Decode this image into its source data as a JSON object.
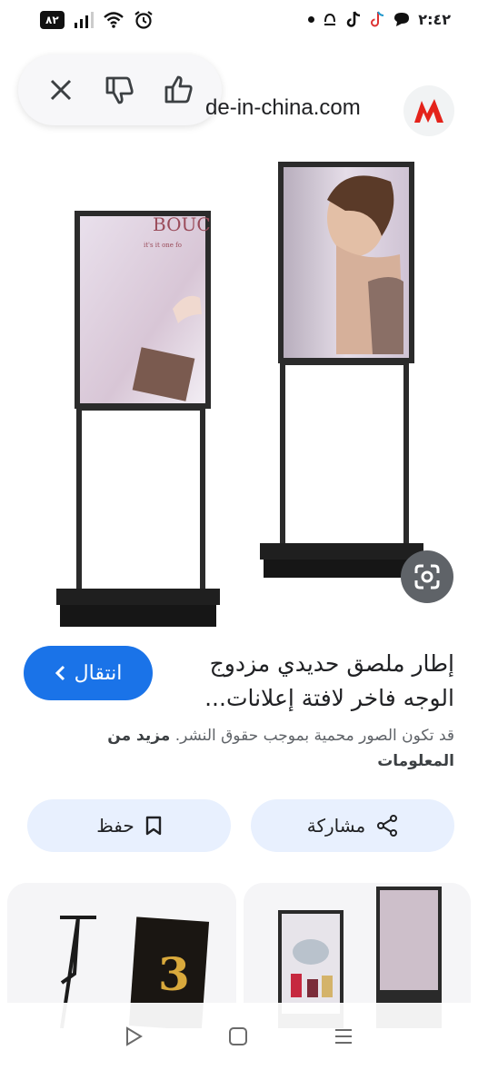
{
  "status_bar": {
    "battery": "٨٢",
    "time": "٢:٤٢"
  },
  "source": {
    "site": "de-in-china.com"
  },
  "product": {
    "title": "إطار ملصق حديدي مزدوج الوجه فاخر لافتة إعلانات...",
    "visit_label": "انتقال",
    "copyright_text": "قد تكون الصور محمية بموجب حقوق النشر.",
    "more_info_label": "مزيد من المعلومات"
  },
  "actions": {
    "save_label": "حفظ",
    "share_label": "مشاركة"
  },
  "colors": {
    "accent": "#1a73e8",
    "button_bg": "#e8f0fe",
    "logo_red": "#e4231b"
  },
  "icons": {
    "close": "close-icon",
    "dislike": "thumb-down-icon",
    "like": "thumb-up-icon",
    "lens": "lens-icon",
    "bookmark": "bookmark-icon",
    "share": "share-icon"
  }
}
